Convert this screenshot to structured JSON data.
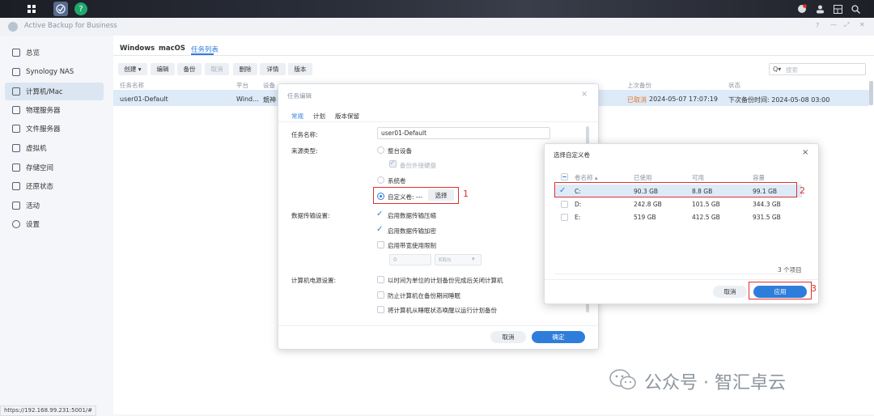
{
  "taskbar": {
    "icons": [
      "grid-icon",
      "app-icon",
      "help-icon"
    ],
    "right_icons": [
      "chat-icon",
      "user-icon",
      "widgets-icon",
      "search-icon"
    ]
  },
  "window": {
    "title": "Active Backup for Business",
    "controls": [
      "?",
      "—",
      "⤢",
      "✕"
    ]
  },
  "sidebar": {
    "items": [
      {
        "label": "总览",
        "icon": "overview-icon"
      },
      {
        "label": "Synology NAS",
        "icon": "nas-icon"
      },
      {
        "label": "计算机/Mac",
        "icon": "computer-icon"
      },
      {
        "label": "物理服务器",
        "icon": "server-icon"
      },
      {
        "label": "文件服务器",
        "icon": "file-server-icon"
      },
      {
        "label": "虚拟机",
        "icon": "vm-icon"
      },
      {
        "label": "存储空间",
        "icon": "storage-icon"
      },
      {
        "label": "还原状态",
        "icon": "restore-icon"
      },
      {
        "label": "活动",
        "icon": "activity-icon"
      },
      {
        "label": "设置",
        "icon": "gear-icon"
      }
    ]
  },
  "main": {
    "tabs": [
      "Windows",
      "macOS",
      "任务列表"
    ],
    "toolbar": [
      "创建 ▾",
      "编辑",
      "备份",
      "取消",
      "删除",
      "详情",
      "版本"
    ],
    "search_placeholder": "搜索",
    "columns": [
      "任务名称",
      "平台",
      "设备",
      "上次备份",
      "状态"
    ],
    "row": {
      "name": "user01-Default",
      "platform": "Wind...",
      "device": "競神",
      "last_status": "已取消",
      "last_time": "2024-05-07 17:07:19",
      "status": "下次备份时间: 2024-05-08 03:00"
    }
  },
  "task_dialog": {
    "title": "任务编辑",
    "tabs": [
      "常规",
      "计划",
      "版本保留"
    ],
    "task_name_label": "任务名称:",
    "task_name_value": "user01-Default",
    "source_label": "来源类型:",
    "source_options": [
      "整台设备",
      "备份外接硬盘",
      "系统卷",
      "自定义卷: ---"
    ],
    "select_button": "选择",
    "transfer_label": "数据传输设置:",
    "transfer_options": [
      "启用数据传输压缩",
      "启用数据传输加密",
      "启用带宽使用限制"
    ],
    "bandwidth_value": "0",
    "bandwidth_unit": "KB/s",
    "power_label": "计算机电源设置:",
    "power_options": [
      "以时间为单位的计划备份完成后关闭计算机",
      "防止计算机在备份期间睡眠",
      "将计算机从睡眠状态唤醒以运行计划备份"
    ],
    "cancel": "取消",
    "ok": "确定"
  },
  "volume_dialog": {
    "title": "选择自定义卷",
    "columns": [
      "卷名称 ▴",
      "已使用",
      "可用",
      "容量"
    ],
    "rows": [
      {
        "name": "C:",
        "used": "90.3 GB",
        "free": "8.8 GB",
        "capacity": "99.1 GB",
        "checked": true
      },
      {
        "name": "D:",
        "used": "242.8 GB",
        "free": "101.5 GB",
        "capacity": "344.3 GB",
        "checked": false
      },
      {
        "name": "E:",
        "used": "519 GB",
        "free": "412.5 GB",
        "capacity": "931.5 GB",
        "checked": false
      }
    ],
    "count": "3 个项目",
    "cancel": "取消",
    "apply": "应用"
  },
  "annotations": [
    "1",
    "2",
    "3"
  ],
  "watermark": "公众号 · 智汇卓云",
  "status_url": "https://192.168.99.231:5001/#",
  "colors": {
    "accent": "#2f7ddb",
    "annotation": "#e0302b",
    "cancelled": "#e2762a"
  }
}
